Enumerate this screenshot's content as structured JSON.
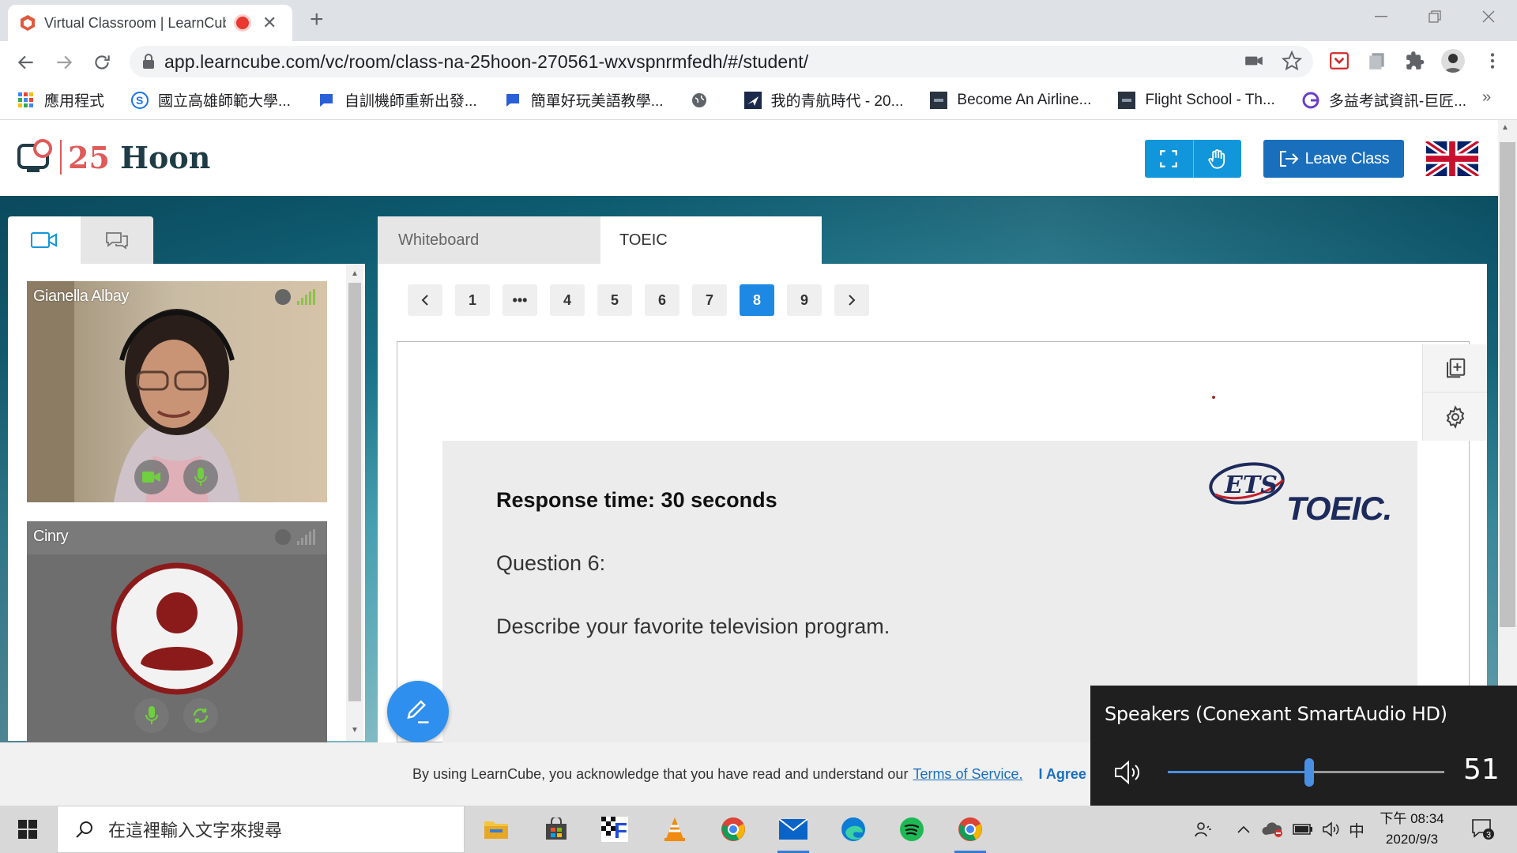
{
  "browser": {
    "tab_title": "Virtual Classroom | LearnCube",
    "url": "app.learncube.com/vc/room/class-na-25hoon-270561-wxvspnrmfedh/#/student/",
    "bookmarks": [
      {
        "label": "應用程式",
        "icon": "apps-grid-icon",
        "color": "#4285f4"
      },
      {
        "label": "國立高雄師範大學...",
        "icon": "s-logo-icon",
        "color": "#1a73e8"
      },
      {
        "label": "自訓機師重新出發...",
        "icon": "chat-bubble-icon",
        "color": "#2b5fd9"
      },
      {
        "label": "簡單好玩美語教學...",
        "icon": "chat-bubble-icon",
        "color": "#2b5fd9"
      },
      {
        "label": "",
        "icon": "globe-icon",
        "color": "#5f6368"
      },
      {
        "label": "我的青航時代 - 20...",
        "icon": "plane-icon",
        "color": "#1b2a4a"
      },
      {
        "label": "Become An Airline...",
        "icon": "dark-square-icon",
        "color": "#2a3340"
      },
      {
        "label": "Flight School - Th...",
        "icon": "dark-square-icon",
        "color": "#2a3340"
      },
      {
        "label": "多益考試資訊-巨匠...",
        "icon": "g-logo-icon",
        "color": "#6a3fc8"
      }
    ]
  },
  "app": {
    "logo_prefix": "25",
    "logo_suffix": "Hoon",
    "leave_label": "Leave Class"
  },
  "participants": [
    {
      "name": "Gianella Albay",
      "video": true
    },
    {
      "name": "Cinry",
      "video": false
    }
  ],
  "whiteboard": {
    "tabs": [
      "Whiteboard",
      "TOEIC"
    ],
    "active_tab": "TOEIC",
    "pages": [
      "1",
      "•••",
      "4",
      "5",
      "6",
      "7",
      "8",
      "9"
    ],
    "active_page": "8",
    "slide": {
      "response": "Response time: 30 seconds",
      "question_num": "Question 6:",
      "question": "Describe your favorite television program.",
      "brand_ets": "ETS",
      "brand_toeic": "TOEIC."
    }
  },
  "terms": {
    "text": "By using LearnCube, you acknowledge that you have read and understand our",
    "link": "Terms of Service.",
    "agree": "I Agree"
  },
  "volume": {
    "device": "Speakers (Conexant SmartAudio HD)",
    "level": 51,
    "level_label": "51"
  },
  "taskbar": {
    "search_placeholder": "在這裡輸入文字來搜尋",
    "clock_time": "下午 08:34",
    "clock_date": "2020/9/3",
    "ime": "中",
    "notifications": "3"
  },
  "colors": {
    "accent": "#1296db",
    "leave": "#1a6fbd",
    "page_active": "#1e88e5",
    "avatar": "#8b1a1a"
  }
}
